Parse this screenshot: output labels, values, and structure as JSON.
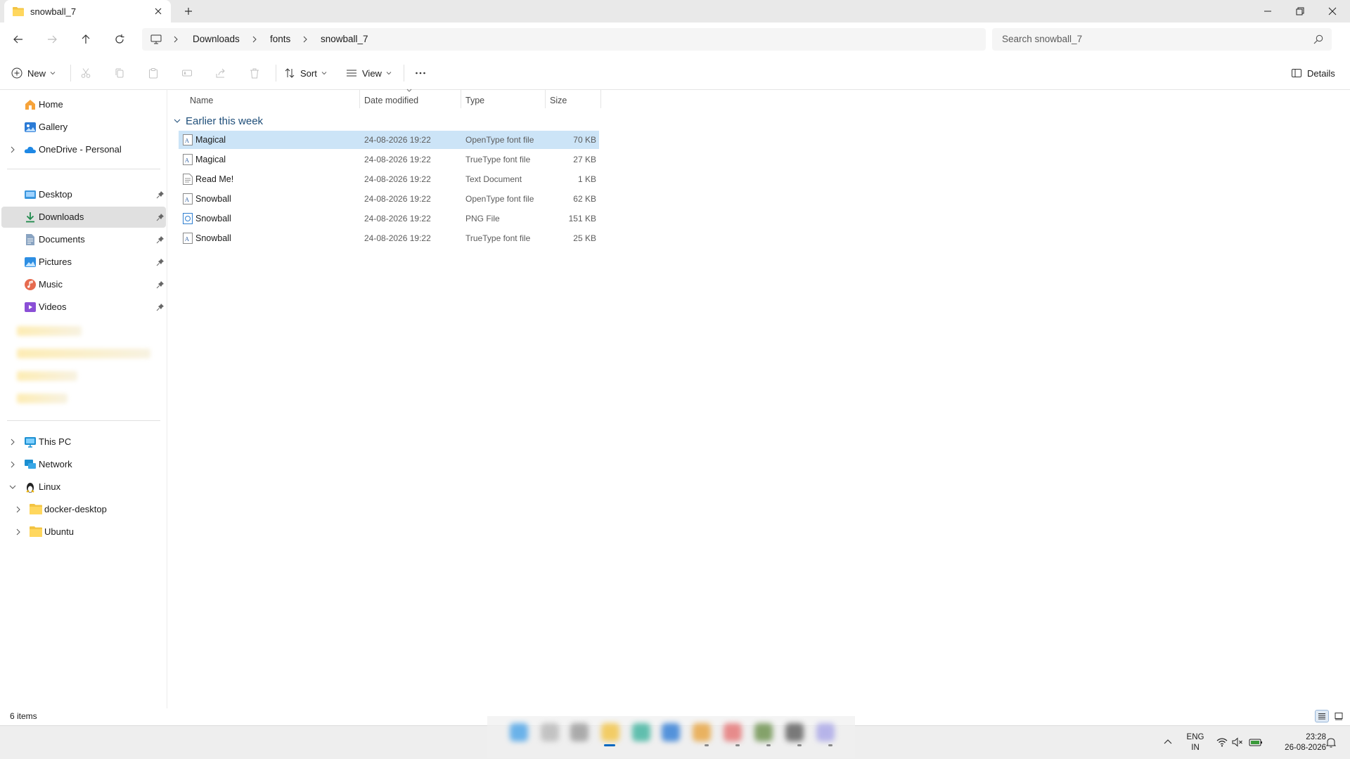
{
  "window": {
    "tab_title": "snowball_7",
    "accent": "#0067c0",
    "selection_color": "#cce4f7"
  },
  "address": {
    "breadcrumbs": [
      "Downloads",
      "fonts",
      "snowball_7"
    ],
    "search_placeholder": "Search snowball_7"
  },
  "toolbar": {
    "new_label": "New",
    "sort_label": "Sort",
    "view_label": "View",
    "details_label": "Details",
    "icons": [
      "cut-icon",
      "copy-icon",
      "paste-icon",
      "rename-icon",
      "share-icon",
      "delete-icon"
    ]
  },
  "sidebar": {
    "top": [
      {
        "label": "Home",
        "icon": "home-icon"
      },
      {
        "label": "Gallery",
        "icon": "gallery-icon"
      },
      {
        "label": "OneDrive - Personal",
        "icon": "onedrive-icon"
      }
    ],
    "pinned": [
      {
        "label": "Desktop",
        "icon": "desktop-icon"
      },
      {
        "label": "Downloads",
        "icon": "downloads-icon",
        "selected": true
      },
      {
        "label": "Documents",
        "icon": "documents-icon"
      },
      {
        "label": "Pictures",
        "icon": "pictures-icon"
      },
      {
        "label": "Music",
        "icon": "music-icon"
      },
      {
        "label": "Videos",
        "icon": "videos-icon"
      }
    ],
    "bottom": [
      {
        "label": "This PC",
        "icon": "pc-icon"
      },
      {
        "label": "Network",
        "icon": "network-icon"
      },
      {
        "label": "Linux",
        "icon": "linux-icon",
        "expanded": true
      },
      {
        "label": "docker-desktop",
        "icon": "folder-icon"
      },
      {
        "label": "Ubuntu",
        "icon": "folder-icon"
      }
    ]
  },
  "columns": {
    "name": "Name",
    "date": "Date modified",
    "type": "Type",
    "size": "Size"
  },
  "group_label": "Earlier this week",
  "files": [
    {
      "name": "Magical",
      "date": "24-08-2026 19:22",
      "type": "OpenType font file",
      "size": "70 KB",
      "selected": true,
      "icon": "font-file-icon"
    },
    {
      "name": "Magical",
      "date": "24-08-2026 19:22",
      "type": "TrueType font file",
      "size": "27 KB",
      "icon": "font-file-icon"
    },
    {
      "name": "Read Me!",
      "date": "24-08-2026 19:22",
      "type": "Text Document",
      "size": "1 KB",
      "icon": "text-file-icon"
    },
    {
      "name": "Snowball",
      "date": "24-08-2026 19:22",
      "type": "OpenType font file",
      "size": "62 KB",
      "icon": "font-file-icon"
    },
    {
      "name": "Snowball",
      "date": "24-08-2026 19:22",
      "type": "PNG File",
      "size": "151 KB",
      "icon": "png-file-icon"
    },
    {
      "name": "Snowball",
      "date": "24-08-2026 19:22",
      "type": "TrueType font file",
      "size": "25 KB",
      "icon": "font-file-icon"
    }
  ],
  "status": {
    "item_count": "6 items"
  },
  "taskbar": {
    "lang": "ENG",
    "region": "IN",
    "time": "23:28",
    "date": "26-08-2026"
  }
}
